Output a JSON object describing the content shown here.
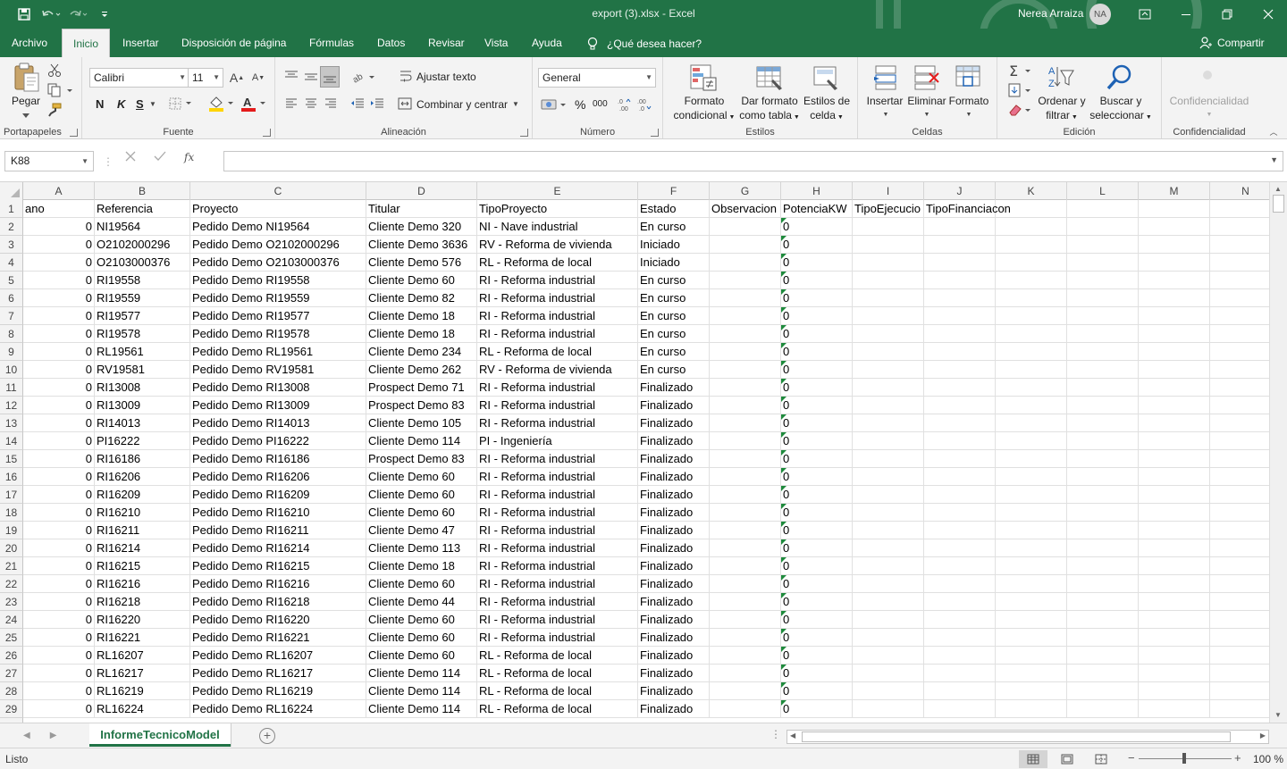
{
  "titlebar": {
    "doc_title": "export (3).xlsx  -  Excel",
    "user_name": "Nerea Arraiza",
    "user_initials": "NA"
  },
  "tabs": [
    {
      "label": "Archivo"
    },
    {
      "label": "Inicio",
      "active": true
    },
    {
      "label": "Insertar"
    },
    {
      "label": "Disposición de página"
    },
    {
      "label": "Fórmulas"
    },
    {
      "label": "Datos"
    },
    {
      "label": "Revisar"
    },
    {
      "label": "Vista"
    },
    {
      "label": "Ayuda"
    }
  ],
  "tell_me": "¿Qué desea hacer?",
  "share_label": "Compartir",
  "ribbon": {
    "clipboard": {
      "paste": "Pegar",
      "label": "Portapapeles"
    },
    "font": {
      "name": "Calibri",
      "size": "11",
      "bold": "N",
      "italic": "K",
      "underline": "S",
      "label": "Fuente"
    },
    "alignment": {
      "wrap": "Ajustar texto",
      "merge": "Combinar y centrar",
      "label": "Alineación"
    },
    "number": {
      "format": "General",
      "percent": "%",
      "thousands": "000",
      "label": "Número"
    },
    "styles": {
      "cond_format_1": "Formato",
      "cond_format_2": "condicional",
      "table_format_1": "Dar formato",
      "table_format_2": "como tabla",
      "cell_styles_1": "Estilos de",
      "cell_styles_2": "celda",
      "label": "Estilos"
    },
    "cells": {
      "insert": "Insertar",
      "delete": "Eliminar",
      "format": "Formato",
      "label": "Celdas"
    },
    "editing": {
      "sort_1": "Ordenar y",
      "sort_2": "filtrar",
      "find_1": "Buscar y",
      "find_2": "seleccionar",
      "label": "Edición"
    },
    "sensitivity": {
      "button": "Confidencialidad",
      "label": "Confidencialidad"
    }
  },
  "formula_bar": {
    "name_box": "K88",
    "fx": "fx",
    "formula": ""
  },
  "columns": [
    "A",
    "B",
    "C",
    "D",
    "E",
    "F",
    "G",
    "H",
    "I",
    "J",
    "K",
    "L",
    "M",
    "N"
  ],
  "header_row": [
    "ano",
    "Referencia",
    "Proyecto",
    "Titular",
    "TipoProyecto",
    "Estado",
    "Observacion",
    "PotenciaKW",
    "TipoEjecucio",
    "TipoFinanciacon"
  ],
  "rows": [
    {
      "n": "2",
      "a": "0",
      "b": "NI19564",
      "c": "Pedido Demo NI19564",
      "d": "Cliente Demo 320",
      "e": "NI - Nave industrial",
      "f": "En curso",
      "h": "0"
    },
    {
      "n": "3",
      "a": "0",
      "b": "O2102000296",
      "c": "Pedido Demo O2102000296",
      "d": "Cliente Demo 3636",
      "e": "RV - Reforma de vivienda",
      "f": "Iniciado",
      "h": "0"
    },
    {
      "n": "4",
      "a": "0",
      "b": "O2103000376",
      "c": "Pedido Demo O2103000376",
      "d": "Cliente Demo 576",
      "e": "RL - Reforma de local",
      "f": "Iniciado",
      "h": "0"
    },
    {
      "n": "5",
      "a": "0",
      "b": "RI19558",
      "c": "Pedido Demo RI19558",
      "d": "Cliente Demo 60",
      "e": "RI - Reforma industrial",
      "f": "En curso",
      "h": "0"
    },
    {
      "n": "6",
      "a": "0",
      "b": "RI19559",
      "c": "Pedido Demo RI19559",
      "d": "Cliente Demo 82",
      "e": "RI - Reforma industrial",
      "f": "En curso",
      "h": "0"
    },
    {
      "n": "7",
      "a": "0",
      "b": "RI19577",
      "c": "Pedido Demo RI19577",
      "d": "Cliente Demo 18",
      "e": "RI - Reforma industrial",
      "f": "En curso",
      "h": "0"
    },
    {
      "n": "8",
      "a": "0",
      "b": "RI19578",
      "c": "Pedido Demo RI19578",
      "d": "Cliente Demo 18",
      "e": "RI - Reforma industrial",
      "f": "En curso",
      "h": "0"
    },
    {
      "n": "9",
      "a": "0",
      "b": "RL19561",
      "c": "Pedido Demo RL19561",
      "d": "Cliente Demo 234",
      "e": "RL - Reforma de local",
      "f": "En curso",
      "h": "0"
    },
    {
      "n": "10",
      "a": "0",
      "b": "RV19581",
      "c": "Pedido Demo RV19581",
      "d": "Cliente Demo 262",
      "e": "RV - Reforma de vivienda",
      "f": "En curso",
      "h": "0"
    },
    {
      "n": "11",
      "a": "0",
      "b": "RI13008",
      "c": "Pedido Demo RI13008",
      "d": "Prospect Demo 71",
      "e": "RI - Reforma industrial",
      "f": "Finalizado",
      "h": "0"
    },
    {
      "n": "12",
      "a": "0",
      "b": "RI13009",
      "c": "Pedido Demo RI13009",
      "d": "Prospect Demo 83",
      "e": "RI - Reforma industrial",
      "f": "Finalizado",
      "h": "0"
    },
    {
      "n": "13",
      "a": "0",
      "b": "RI14013",
      "c": "Pedido Demo RI14013",
      "d": "Cliente Demo 105",
      "e": "RI - Reforma industrial",
      "f": "Finalizado",
      "h": "0"
    },
    {
      "n": "14",
      "a": "0",
      "b": "PI16222",
      "c": "Pedido Demo PI16222",
      "d": "Cliente Demo 114",
      "e": "PI - Ingeniería",
      "f": "Finalizado",
      "h": "0"
    },
    {
      "n": "15",
      "a": "0",
      "b": "RI16186",
      "c": "Pedido Demo RI16186",
      "d": "Prospect Demo 83",
      "e": "RI - Reforma industrial",
      "f": "Finalizado",
      "h": "0"
    },
    {
      "n": "16",
      "a": "0",
      "b": "RI16206",
      "c": "Pedido Demo RI16206",
      "d": "Cliente Demo 60",
      "e": "RI - Reforma industrial",
      "f": "Finalizado",
      "h": "0"
    },
    {
      "n": "17",
      "a": "0",
      "b": "RI16209",
      "c": "Pedido Demo RI16209",
      "d": "Cliente Demo 60",
      "e": "RI - Reforma industrial",
      "f": "Finalizado",
      "h": "0"
    },
    {
      "n": "18",
      "a": "0",
      "b": "RI16210",
      "c": "Pedido Demo RI16210",
      "d": "Cliente Demo 60",
      "e": "RI - Reforma industrial",
      "f": "Finalizado",
      "h": "0"
    },
    {
      "n": "19",
      "a": "0",
      "b": "RI16211",
      "c": "Pedido Demo RI16211",
      "d": "Cliente Demo 47",
      "e": "RI - Reforma industrial",
      "f": "Finalizado",
      "h": "0"
    },
    {
      "n": "20",
      "a": "0",
      "b": "RI16214",
      "c": "Pedido Demo RI16214",
      "d": "Cliente Demo 113",
      "e": "RI - Reforma industrial",
      "f": "Finalizado",
      "h": "0"
    },
    {
      "n": "21",
      "a": "0",
      "b": "RI16215",
      "c": "Pedido Demo RI16215",
      "d": "Cliente Demo 18",
      "e": "RI - Reforma industrial",
      "f": "Finalizado",
      "h": "0"
    },
    {
      "n": "22",
      "a": "0",
      "b": "RI16216",
      "c": "Pedido Demo RI16216",
      "d": "Cliente Demo 60",
      "e": "RI - Reforma industrial",
      "f": "Finalizado",
      "h": "0"
    },
    {
      "n": "23",
      "a": "0",
      "b": "RI16218",
      "c": "Pedido Demo RI16218",
      "d": "Cliente Demo 44",
      "e": "RI - Reforma industrial",
      "f": "Finalizado",
      "h": "0"
    },
    {
      "n": "24",
      "a": "0",
      "b": "RI16220",
      "c": "Pedido Demo RI16220",
      "d": "Cliente Demo 60",
      "e": "RI - Reforma industrial",
      "f": "Finalizado",
      "h": "0"
    },
    {
      "n": "25",
      "a": "0",
      "b": "RI16221",
      "c": "Pedido Demo RI16221",
      "d": "Cliente Demo 60",
      "e": "RI - Reforma industrial",
      "f": "Finalizado",
      "h": "0"
    },
    {
      "n": "26",
      "a": "0",
      "b": "RL16207",
      "c": "Pedido Demo RL16207",
      "d": "Cliente Demo 60",
      "e": "RL - Reforma de local",
      "f": "Finalizado",
      "h": "0"
    },
    {
      "n": "27",
      "a": "0",
      "b": "RL16217",
      "c": "Pedido Demo RL16217",
      "d": "Cliente Demo 114",
      "e": "RL - Reforma de local",
      "f": "Finalizado",
      "h": "0"
    },
    {
      "n": "28",
      "a": "0",
      "b": "RL16219",
      "c": "Pedido Demo RL16219",
      "d": "Cliente Demo 114",
      "e": "RL - Reforma de local",
      "f": "Finalizado",
      "h": "0"
    },
    {
      "n": "29",
      "a": "0",
      "b": "RL16224",
      "c": "Pedido Demo RL16224",
      "d": "Cliente Demo 114",
      "e": "RL - Reforma de local",
      "f": "Finalizado",
      "h": "0"
    }
  ],
  "sheet_tab": "InformeTecnicoModel",
  "status": {
    "ready": "Listo",
    "zoom": "100 %"
  },
  "colors": {
    "accent": "#217346",
    "comment_triangle": "#1e8a3c"
  }
}
